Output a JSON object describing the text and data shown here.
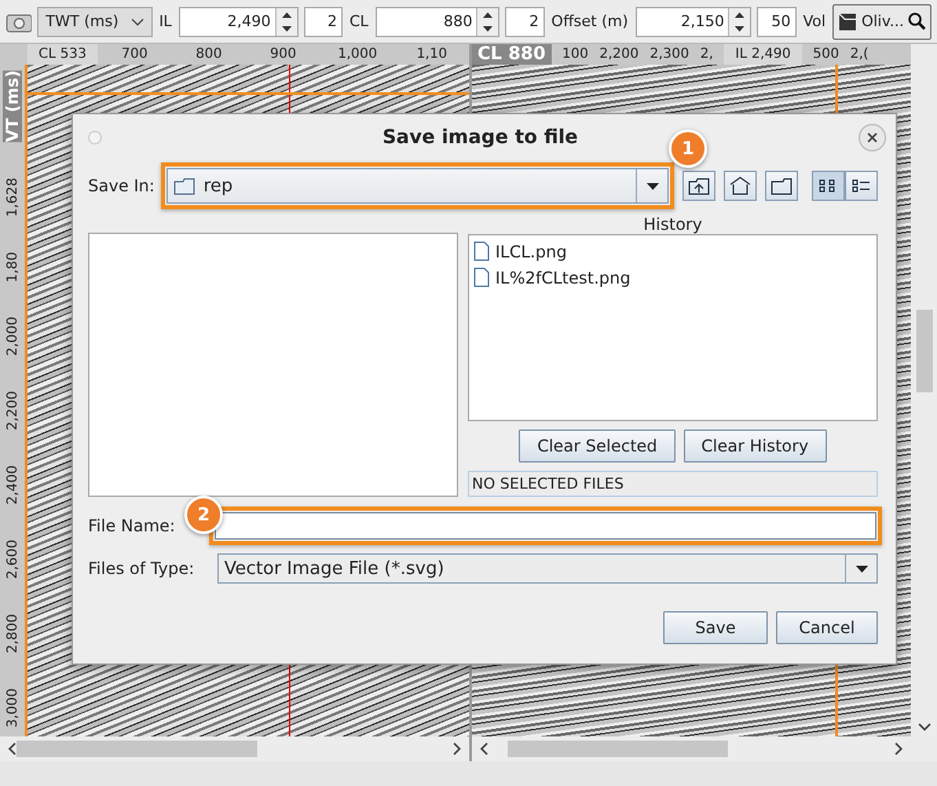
{
  "toolbar": {
    "domain": "TWT (ms)",
    "il_label": "IL",
    "il_value": "2,490",
    "il_step": "2",
    "cl_label": "CL",
    "cl_value": "880",
    "cl_step": "2",
    "offset_label": "Offset (m)",
    "offset_value": "2,150",
    "offset_step": "50",
    "vol_label": "Vol",
    "vol_value": "Oliv..."
  },
  "left_panel": {
    "section_label": "CL 533",
    "x_ticks": [
      "700",
      "800",
      "900",
      "1,000",
      "1,10"
    ],
    "y_axis_title": "VT (ms)",
    "y_ticks": [
      "1,628",
      "1,80",
      "2,000",
      "2,200",
      "2,400",
      "2,600",
      "2,800",
      "3,000"
    ]
  },
  "right_panel": {
    "section_label": "CL 880",
    "x_ticks": [
      "100",
      "2,200",
      "2,300",
      "2,"
    ],
    "crossline_label": "IL 2,490",
    "x_ticks_after": [
      "500",
      "2,("
    ]
  },
  "dialog": {
    "title": "Save image to file",
    "save_in_label": "Save In:",
    "save_in_value": "rep",
    "history_label": "History",
    "history_files": [
      "ILCL.png",
      "IL%2fCLtest.png"
    ],
    "history_buttons": [
      "Clear Selected",
      "Clear History"
    ],
    "selection_status": "NO SELECTED FILES",
    "file_name_label": "File Name:",
    "files_of_type_label": "Files of Type:",
    "files_of_type_value": "Vector Image File (*.svg)",
    "actions": [
      "Save",
      "Cancel"
    ]
  },
  "callouts": [
    {
      "number": "1"
    },
    {
      "number": "2"
    }
  ]
}
